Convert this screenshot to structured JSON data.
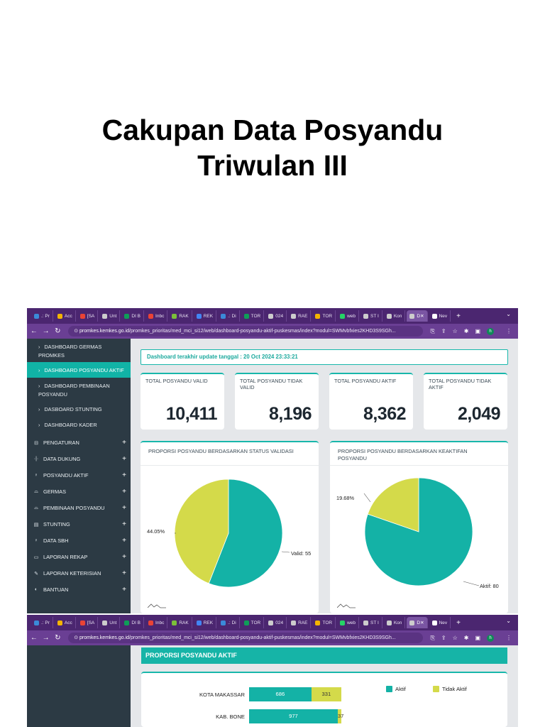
{
  "slide": {
    "title_line1": "Cakupan Data Posyandu",
    "title_line2": "Triwulan III"
  },
  "browser": {
    "tabs": [
      {
        "label": ".: Pr",
        "color": "#3b8ad8"
      },
      {
        "label": "Acc",
        "color": "#f4b400"
      },
      {
        "label": "[SA",
        "color": "#ea4335"
      },
      {
        "label": "Unt",
        "color": "#cccccc"
      },
      {
        "label": "DI B",
        "color": "#0f9d58"
      },
      {
        "label": "Inbc",
        "color": "#ea4335"
      },
      {
        "label": "RAK",
        "color": "#7bbf3a"
      },
      {
        "label": "REK",
        "color": "#4285f4"
      },
      {
        "label": ".: Di",
        "color": "#3b8ad8"
      },
      {
        "label": "TOR",
        "color": "#0f9d58"
      },
      {
        "label": "024",
        "color": "#cccccc"
      },
      {
        "label": "RAE",
        "color": "#cccccc"
      },
      {
        "label": "TOR",
        "color": "#f4b400"
      },
      {
        "label": "web",
        "color": "#25d366"
      },
      {
        "label": "ST I",
        "color": "#cccccc"
      },
      {
        "label": "Kon",
        "color": "#cccccc"
      },
      {
        "label": "D",
        "color": "#cccccc"
      },
      {
        "label": "Nev",
        "color": "#ffffff"
      }
    ],
    "url_host": "promkes.kemkes.go.id",
    "url_path": "/promkes_prioritas/med_mci_si12/web/dashboard-posyandu-aktif-puskesmas/index?modul=SWMvbfxies2KHD3S9SGh...",
    "avatar_letter": "h"
  },
  "sidebar": {
    "sub_items": [
      {
        "label": "DASHBOARD GERMAS PROMKES",
        "active": false
      },
      {
        "label": "DASHBOARD POSYANDU AKTIF",
        "active": true
      },
      {
        "label": "DASHBOARD PEMBINAAN POSYANDU",
        "active": false
      },
      {
        "label": "DASBOARD STUNTING",
        "active": false
      },
      {
        "label": "DASHBOARD KADER",
        "active": false
      }
    ],
    "menu": [
      {
        "label": "PENGATURAN",
        "icon": "cart-icon"
      },
      {
        "label": "DATA DUKUNG",
        "icon": "data-icon"
      },
      {
        "label": "POSYANDU AKTIF",
        "icon": "pin-icon"
      },
      {
        "label": "GERMAS",
        "icon": "leaf-icon"
      },
      {
        "label": "PEMBINAAN POSYANDU",
        "icon": "leaf-icon"
      },
      {
        "label": "STUNTING",
        "icon": "calendar-icon"
      },
      {
        "label": "DATA SBH",
        "icon": "pin-icon"
      },
      {
        "label": "LAPORAN REKAP",
        "icon": "monitor-icon"
      },
      {
        "label": "LAPORAN KETERISIAN",
        "icon": "edit-icon"
      },
      {
        "label": "BANTUAN",
        "icon": "headset-icon"
      }
    ]
  },
  "dashboard": {
    "update_text": "Dashboard terakhir update tanggal : 20 Oct 2024 23:33:21",
    "kpis": [
      {
        "title": "TOTAL POSYANDU VALID",
        "value": "10,411"
      },
      {
        "title": "TOTAL POSYANDU TIDAK VALID",
        "value": "8,196"
      },
      {
        "title": "TOTAL POSYANDU AKTIF",
        "value": "8,362"
      },
      {
        "title": "TOTAL POSYANDU TIDAK AKTIF",
        "value": "2,049"
      }
    ],
    "pie_validasi": {
      "title": "PROPORSI POSYANDU BERDASARKAN STATUS VALIDASI",
      "label_small": "44.05%",
      "label_big": "Valid: 55",
      "colors": [
        "#14b2a6",
        "#d4da4a"
      ]
    },
    "pie_keaktifan": {
      "title": "PROPORSI POSYANDU BERDASARKAN KEAKTIFAN POSYANDU",
      "label_small": "19.68%",
      "label_big": "Aktif: 80",
      "colors": [
        "#14b2a6",
        "#d4da4a"
      ]
    },
    "aktif_section": {
      "title": "PROPORSI POSYANDU AKTIF",
      "legend": [
        {
          "label": "Aktif",
          "color": "#14b2a6"
        },
        {
          "label": "Tidak Aktif",
          "color": "#d4da4a"
        }
      ]
    }
  },
  "chart_data": [
    {
      "type": "pie",
      "title": "PROPORSI POSYANDU BERDASARKAN STATUS VALIDASI",
      "slices": [
        {
          "name": "Valid",
          "value": 55.95
        },
        {
          "name": "",
          "value": 44.05
        }
      ]
    },
    {
      "type": "pie",
      "title": "PROPORSI POSYANDU BERDASARKAN KEAKTIFAN POSYANDU",
      "slices": [
        {
          "name": "Aktif",
          "value": 80.32
        },
        {
          "name": "",
          "value": 19.68
        }
      ]
    },
    {
      "type": "bar",
      "title": "PROPORSI POSYANDU AKTIF",
      "orientation": "horizontal",
      "stacked": true,
      "categories": [
        "KOTA MAKASSAR",
        "KAB. BONE"
      ],
      "series": [
        {
          "name": "Aktif",
          "values": [
            686,
            977
          ]
        },
        {
          "name": "Tidak Aktif",
          "values": [
            331,
            37
          ]
        }
      ],
      "legend": "top-right"
    }
  ]
}
